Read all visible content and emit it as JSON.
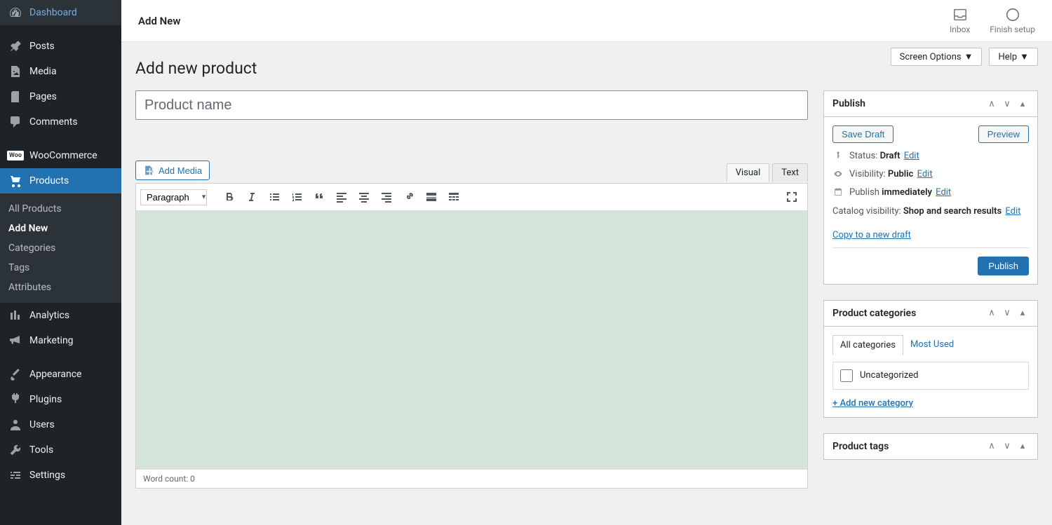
{
  "topbar": {
    "title": "Add New",
    "inbox_label": "Inbox",
    "finish_label": "Finish setup"
  },
  "screen_options": {
    "screen_opts_label": "Screen Options",
    "help_label": "Help"
  },
  "page": {
    "heading": "Add new product",
    "title_placeholder": "Product name"
  },
  "sidebar": {
    "dashboard": "Dashboard",
    "posts": "Posts",
    "media": "Media",
    "pages": "Pages",
    "comments": "Comments",
    "woocommerce": "WooCommerce",
    "products": "Products",
    "analytics": "Analytics",
    "marketing": "Marketing",
    "appearance": "Appearance",
    "plugins": "Plugins",
    "users": "Users",
    "tools": "Tools",
    "settings": "Settings",
    "sub": {
      "all_products": "All Products",
      "add_new": "Add New",
      "categories": "Categories",
      "tags": "Tags",
      "attributes": "Attributes"
    }
  },
  "editor": {
    "add_media": "Add Media",
    "tab_visual": "Visual",
    "tab_text": "Text",
    "format_sel": "Paragraph",
    "word_count": "Word count: 0"
  },
  "publish_box": {
    "title": "Publish",
    "save_draft": "Save Draft",
    "preview": "Preview",
    "status_label": "Status:",
    "status_val": "Draft",
    "visibility_label": "Visibility:",
    "visibility_val": "Public",
    "publish_label": "Publish",
    "publish_val": "immediately",
    "catalog_label": "Catalog visibility:",
    "catalog_val": "Shop and search results",
    "edit": "Edit",
    "copy_link": "Copy to a new draft",
    "publish_btn": "Publish"
  },
  "cat_box": {
    "title": "Product categories",
    "tab_all": "All categories",
    "tab_most": "Most Used",
    "uncategorized": "Uncategorized",
    "add_new": "+ Add new category"
  },
  "tag_box": {
    "title": "Product tags"
  }
}
